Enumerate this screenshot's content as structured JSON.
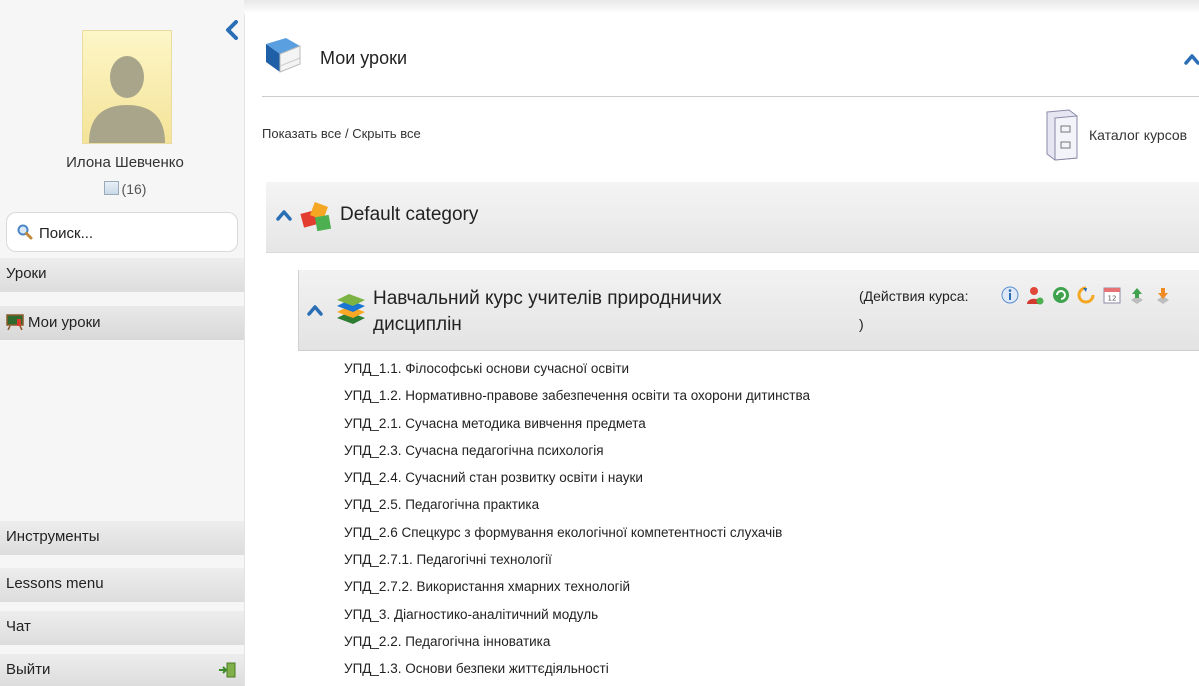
{
  "sidebar": {
    "user_name": "Илона Шевченко",
    "message_count": "(16)",
    "search_placeholder": "Поиск...",
    "sections": [
      {
        "label": "Уроки"
      },
      {
        "label": "Мои уроки"
      },
      {
        "label": "Инструменты"
      },
      {
        "label": "Lessons menu"
      },
      {
        "label": "Чат"
      },
      {
        "label": "Выйти"
      }
    ]
  },
  "header": {
    "title": "Мои уроки"
  },
  "toolbar": {
    "show_hide_all": "Показать все / Скрыть все",
    "catalog_label": "Каталог курсов"
  },
  "category": {
    "label": "Default category"
  },
  "course": {
    "title": "Навчальний курс учителів природничих дисциплін",
    "actions_label": "(Действия курса:",
    "actions_close": ")",
    "action_icons": [
      "info-icon",
      "user-edit-icon",
      "recycle-icon",
      "refresh-icon",
      "calendar-icon",
      "upload-icon",
      "download-icon"
    ]
  },
  "lessons": [
    "УПД_1.1. Філософські основи сучасної освіти",
    "УПД_1.2. Нормативно-правове забезпечення освіти та охорони дитинства",
    "УПД_2.1. Сучасна методика вивчення предмета",
    "УПД_2.3. Сучасна педагогічна психологія",
    "УПД_2.4. Сучасний стан розвитку освіти і науки",
    "УПД_2.5. Педагогічна практика",
    "УПД_2.6 Спецкурс з формування екологічної компетентності слухачів",
    "УПД_2.7.1. Педагогічні технології",
    "УПД_2.7.2. Використання хмарних технологій",
    "УПД_3. Діагностико-аналітичний модуль",
    "УПД_2.2. Педагогічна інноватика",
    "УПД_1.3. Основи безпеки життєдіяльності"
  ],
  "colors": {
    "accent_blue": "#2a6fb5",
    "sidebar_bg": "#f6f6f6",
    "header_gradient_top": "#ededed",
    "header_gradient_bottom": "#dddddd"
  }
}
